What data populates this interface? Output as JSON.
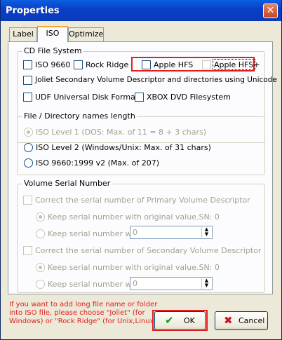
{
  "window": {
    "title": "Properties",
    "close_glyph": "✕"
  },
  "tabs": [
    {
      "label": "Label",
      "active": false
    },
    {
      "label": "ISO",
      "active": true
    },
    {
      "label": "Optimize",
      "active": false
    }
  ],
  "cd_file_system": {
    "title": "CD File System",
    "iso9660": "ISO 9660",
    "rock_ridge": "Rock Ridge",
    "apple_hfs": "Apple HFS",
    "apple_hfs_plus": "Apple HFS+",
    "joliet": "Joliet  Secondary Volume Descriptor and directories using Unicode",
    "udf": "UDF  Universal Disk Format",
    "xbox": "XBOX DVD Filesystem"
  },
  "names_length": {
    "title": "File / Directory names  length",
    "level1": "ISO Level 1 (DOS: Max. of 11 = 8 + 3 chars)",
    "level2": "ISO Level 2 (Windows/Unix: Max. of 31 chars)",
    "v2": "ISO 9660:1999 v2 (Max. of 207)"
  },
  "volume_serial": {
    "title": "Volume Serial Number",
    "primary_correct": "Correct the serial number of  Primary Volume Descriptor",
    "primary_keep": "Keep serial number with original value.SN: 0",
    "primary_with": "Keep serial number with",
    "primary_value": "0",
    "secondary_correct": "Correct the serial number of  Secondary Volume Descriptor",
    "secondary_keep": "Keep serial number with original value.SN: 0",
    "secondary_with": "Keep serial number with",
    "secondary_value": "0"
  },
  "note": {
    "line1": "If you want to add long file name or folder",
    "line2": "into ISO file, please choose \"Joliet\" (for",
    "line3": "Windows) or \"Rock Ridge\" (for Unix,Linux)."
  },
  "buttons": {
    "ok": "OK",
    "cancel": "Cancel"
  },
  "colors": {
    "highlight": "#e31e1e",
    "title_bar": "#0a4fd8",
    "disabled_text": "#a2a08e"
  }
}
